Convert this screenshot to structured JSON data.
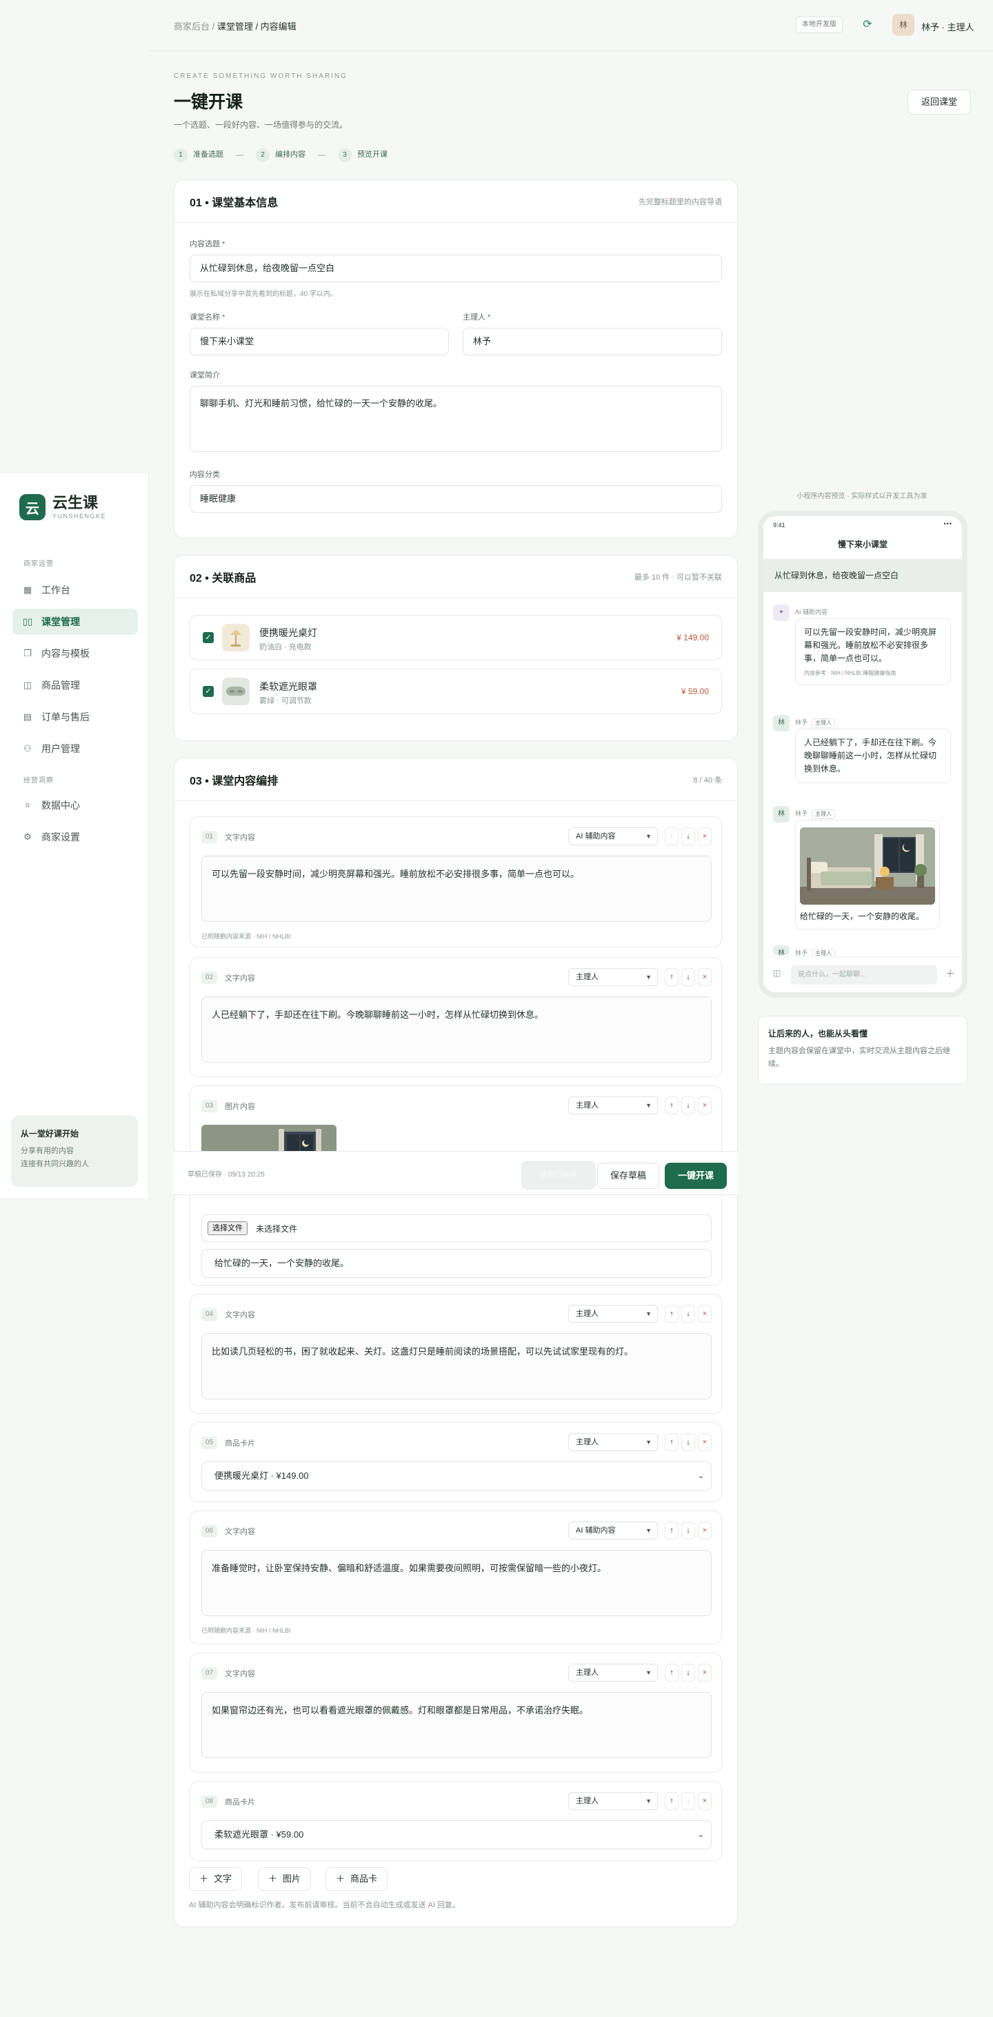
{
  "brand": {
    "logo": "云",
    "name": "云生课",
    "sub": "YUNSHENGKE"
  },
  "sidebar": {
    "section_merchant": "商家运营",
    "section_ops": "经营洞察",
    "items": [
      {
        "label": "工作台",
        "icon": "dashboard-icon"
      },
      {
        "label": "课堂管理",
        "icon": "book-icon",
        "active": true
      },
      {
        "label": "内容与模板",
        "icon": "template-icon"
      },
      {
        "label": "商品管理",
        "icon": "bag-icon"
      },
      {
        "label": "订单与售后",
        "icon": "order-icon"
      },
      {
        "label": "用户管理",
        "icon": "users-icon"
      },
      {
        "label": "数据中心",
        "icon": "chart-icon"
      },
      {
        "label": "商家设置",
        "icon": "gear-icon"
      }
    ],
    "card": {
      "title": "从一堂好课开始",
      "line1": "分享有用的内容",
      "line2": "连接有共同兴趣的人"
    }
  },
  "topbar": {
    "crumb_root": "商家后台 / ",
    "crumb_current": "课堂管理 / 内容编辑",
    "env": "本地开发版",
    "avatar": "林",
    "user": "林予 · 主理人"
  },
  "header": {
    "eyebrow": "CREATE SOMETHING WORTH SHARING",
    "title": "一键开课",
    "subtitle": "一个选题、一段好内容、一场值得参与的交流。",
    "back": "返回课堂",
    "steps": [
      {
        "num": "1",
        "label": "准备选题"
      },
      {
        "num": "2",
        "label": "编排内容"
      },
      {
        "num": "3",
        "label": "预览开课"
      }
    ],
    "step_sep": "—"
  },
  "basic": {
    "title": "01 • 课堂基本信息",
    "note": "先完整标题里的内容导语",
    "topic_label": "内容选题 *",
    "topic_value": "从忙碌到休息，给夜晚留一点空白",
    "topic_hint": "展示在私域分享中首先看到的标题，40 字以内。",
    "name_label": "课堂名称 *",
    "name_value": "慢下来小课堂",
    "host_label": "主理人 *",
    "host_value": "林予",
    "intro_label": "课堂简介",
    "intro_value": "聊聊手机、灯光和睡前习惯，给忙碌的一天一个安静的收尾。",
    "cat_label": "内容分类",
    "cat_value": "睡眠健康"
  },
  "products": {
    "title": "02 • 关联商品",
    "note": "最多 10 件 · 可以暂不关联",
    "items": [
      {
        "name": "便携暖光桌灯",
        "sku": "奶油白 · 充电款",
        "price": "¥ 149.00"
      },
      {
        "name": "柔软遮光眼罩",
        "sku": "雾绿 · 可调节款",
        "price": "¥ 59.00"
      }
    ]
  },
  "content": {
    "title": "03 • 课堂内容编排",
    "count": "8 / 40 条",
    "blocks": [
      {
        "num": "01",
        "type": "文字内容",
        "role": "AI 辅助内容",
        "text": "可以先留一段安静时间，减少明亮屏幕和强光。睡前放松不必安排很多事，简单一点也可以。",
        "foot": "已附随删内容来源 · NIH / NHLBI"
      },
      {
        "num": "02",
        "type": "文字内容",
        "role": "主理人",
        "text": "人已经躺下了，手却还在往下刷。今晚聊聊睡前这一小时，怎样从忙碌切换到休息。"
      },
      {
        "num": "03",
        "type": "图片内容",
        "role": "主理人",
        "file_btn": "选择文件",
        "file_none": "未选择文件",
        "caption": "给忙碌的一天，一个安静的收尾。"
      },
      {
        "num": "04",
        "type": "文字内容",
        "role": "主理人",
        "text": "比如读几页轻松的书，困了就收起来、关灯。这盏灯只是睡前阅读的场景搭配，可以先试试家里现有的灯。"
      },
      {
        "num": "05",
        "type": "商品卡片",
        "role": "主理人",
        "product": "便携暖光桌灯 · ¥149.00"
      },
      {
        "num": "06",
        "type": "文字内容",
        "role": "AI 辅助内容",
        "text": "准备睡觉时，让卧室保持安静、偏暗和舒适温度。如果需要夜间照明，可按需保留暗一些的小夜灯。",
        "foot": "已附随删内容来源 · NIH / NHLBI"
      },
      {
        "num": "07",
        "type": "文字内容",
        "role": "主理人",
        "text": "如果窗帘边还有光，也可以看看遮光眼罩的佩戴感。灯和眼罩都是日常用品，不承诺治疗失眠。"
      },
      {
        "num": "08",
        "type": "商品卡片",
        "role": "主理人",
        "product": "柔软遮光眼罩 · ¥59.00"
      }
    ],
    "add_text": "文字",
    "add_image": "图片",
    "add_product": "商品卡",
    "footnote": "AI 辅助内容会明确标识作者。发布前请审核。当前不会自动生成或发送 AI 回复。"
  },
  "savebar": {
    "status": "草稿已保存 · 09/13 20:25",
    "ghost": "草稿已保存",
    "draft": "保存草稿",
    "publish": "一键开课"
  },
  "preview": {
    "caption": "小程序内容预览 · 实际样式以开发工具为准",
    "time": "9:41",
    "dots": "•••",
    "title": "慢下来小课堂",
    "topic": "从忙碌到休息，给夜晚留一点空白",
    "ai_label": "AI 辅助内容",
    "ai_text": "可以先留一段安静时间，减少明亮屏幕和强光。睡前放松不必安排很多事，简单一点也可以。",
    "ai_src": "内容参考 · NIH / NHLBI 睡眠健康指南",
    "host_name": "林予",
    "host_tag": "主理人",
    "host_text": "人已经躺下了，手却还在往下刷。今晚聊聊睡前这一小时，怎样从忙碌切换到休息。",
    "img_caption": "给忙碌的一天，一个安静的收尾。",
    "av_ai": "✦",
    "av_host": "林",
    "input_placeholder": "说点什么，一起聊聊...",
    "tip_title": "让后来的人，也能从头看懂",
    "tip_text": "主题内容会保留在课堂中，实时交流从主题内容之后继续。"
  },
  "colors": {
    "accent": "#1f6b4f",
    "price": "#c0573c",
    "bg": "#f6f8f6"
  }
}
